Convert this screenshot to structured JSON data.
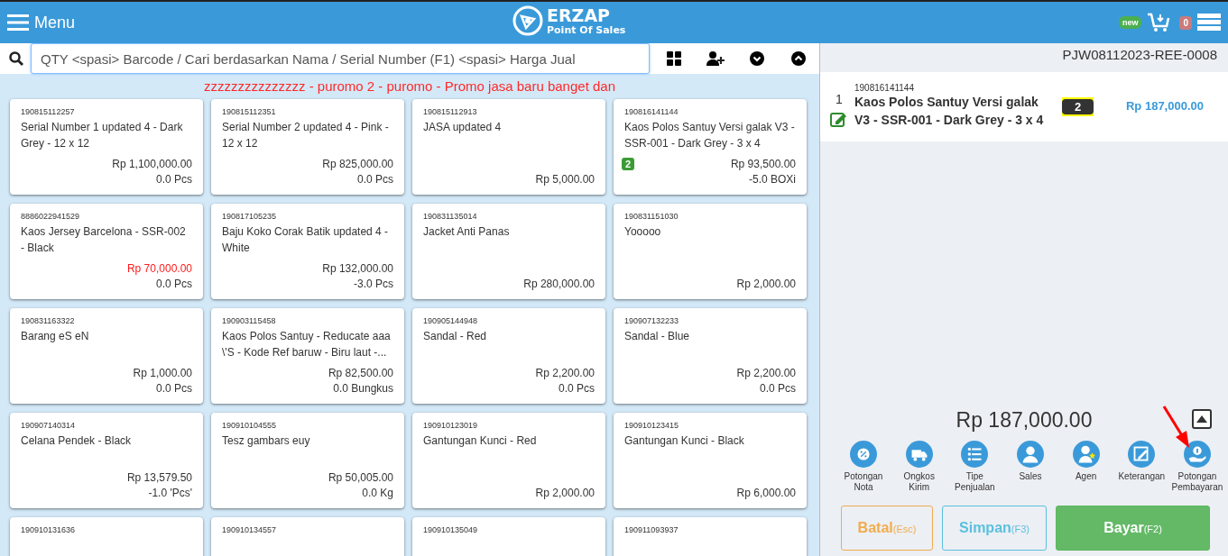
{
  "header": {
    "menu_label": "Menu",
    "logo_title": "ERZAP",
    "logo_subtitle": "Point Of Sales",
    "new_badge": "new",
    "queue_count": "0"
  },
  "search": {
    "placeholder": "QTY <spasi> Barcode / Cari berdasarkan Nama / Serial Number (F1) <spasi> Harga Jual"
  },
  "promo_text": "zzzzzzzzzzzzzzz - puromo 2 - puromo - Promo jasa baru banget dan",
  "products": [
    {
      "code": "190815112257",
      "name": "Serial Number 1 updated 4 - Dark Grey - 12 x 12",
      "price": "Rp 1,100,000.00",
      "price_highlight": false,
      "stock": "0.0 Pcs"
    },
    {
      "code": "190815112351",
      "name": "Serial Number 2 updated 4 - Pink - 12 x 12",
      "price": "Rp 825,000.00",
      "price_highlight": false,
      "stock": "0.0 Pcs"
    },
    {
      "code": "190815112913",
      "name": "JASA updated 4",
      "price": "Rp 5,000.00",
      "price_highlight": false
    },
    {
      "code": "190816141144",
      "name": "Kaos Polos Santuy Versi galak V3 - SSR-001 - Dark Grey - 3 x 4",
      "price": "Rp 93,500.00",
      "price_highlight": false,
      "stock": "-5.0 BOXi",
      "cart_qty": "2"
    },
    {
      "code": "8886022941529",
      "name": "Kaos Jersey Barcelona - SSR-002 - Black",
      "price": "Rp 70,000.00",
      "price_highlight": true,
      "stock": "0.0 Pcs"
    },
    {
      "code": "190817105235",
      "name": "Baju Koko Corak Batik updated 4 - White",
      "price": "Rp 132,000.00",
      "price_highlight": false,
      "stock": "-3.0 Pcs"
    },
    {
      "code": "190831135014",
      "name": "Jacket Anti Panas",
      "price": "Rp 280,000.00",
      "price_highlight": false
    },
    {
      "code": "190831151030",
      "name": "Yooooo",
      "price": "Rp 2,000.00",
      "price_highlight": false
    },
    {
      "code": "190831163322",
      "name": "Barang eS eN",
      "price": "Rp 1,000.00",
      "price_highlight": false,
      "stock": "0.0 Pcs"
    },
    {
      "code": "190903115458",
      "name": "Kaos Polos Santuy - Reducate aaa \\'S - Kode Ref baruw - Biru laut -...",
      "price": "Rp 82,500.00",
      "price_highlight": false,
      "stock": "0.0 Bungkus"
    },
    {
      "code": "190905144948",
      "name": "Sandal - Red",
      "price": "Rp 2,200.00",
      "price_highlight": false,
      "stock": "0.0 Pcs"
    },
    {
      "code": "190907132233",
      "name": "Sandal - Blue",
      "price": "Rp 2,200.00",
      "price_highlight": false,
      "stock": "0.0 Pcs"
    },
    {
      "code": "190907140314",
      "name": "Celana Pendek - Black",
      "price": "Rp 13,579.50",
      "price_highlight": false,
      "stock": "-1.0 'Pcs'"
    },
    {
      "code": "190910104555",
      "name": "Tesz gambars euy",
      "price": "Rp 50,005.00",
      "price_highlight": false,
      "stock": "0.0 Kg"
    },
    {
      "code": "190910123019",
      "name": "Gantungan Kunci - Red",
      "price": "Rp 2,000.00",
      "price_highlight": false
    },
    {
      "code": "190910123415",
      "name": "Gantungan Kunci - Black",
      "price": "Rp 6,000.00",
      "price_highlight": false
    },
    {
      "code": "190910131636"
    },
    {
      "code": "190910134557"
    },
    {
      "code": "190910135049"
    },
    {
      "code": "190911093937"
    }
  ],
  "invoice_number": "PJW08112023-REE-0008",
  "cart_items": [
    {
      "number": "1",
      "code": "190816141144",
      "name": "Kaos Polos Santuy Versi galak V3 - SSR-001 - Dark Grey - 3 x 4",
      "qty": "2",
      "subtotal": "Rp 187,000.00"
    }
  ],
  "total": "Rp 187,000.00",
  "actions": [
    {
      "kind": "discount",
      "label": "Potongan Nota"
    },
    {
      "kind": "shipping",
      "label": "Ongkos Kirim"
    },
    {
      "kind": "list",
      "label": "Tipe Penjualan"
    },
    {
      "kind": "person",
      "label": "Sales"
    },
    {
      "kind": "agent",
      "label": "Agen"
    },
    {
      "kind": "note",
      "label": "Keterangan"
    },
    {
      "kind": "payment",
      "label": "Potongan Pembayaran"
    }
  ],
  "buttons": [
    {
      "kind": "cancel",
      "label": "Batal",
      "shortcut": "(Esc)"
    },
    {
      "kind": "save",
      "label": "Simpan",
      "shortcut": "(F3)"
    },
    {
      "kind": "pay",
      "label": "Bayar",
      "shortcut": "(F2)"
    }
  ]
}
